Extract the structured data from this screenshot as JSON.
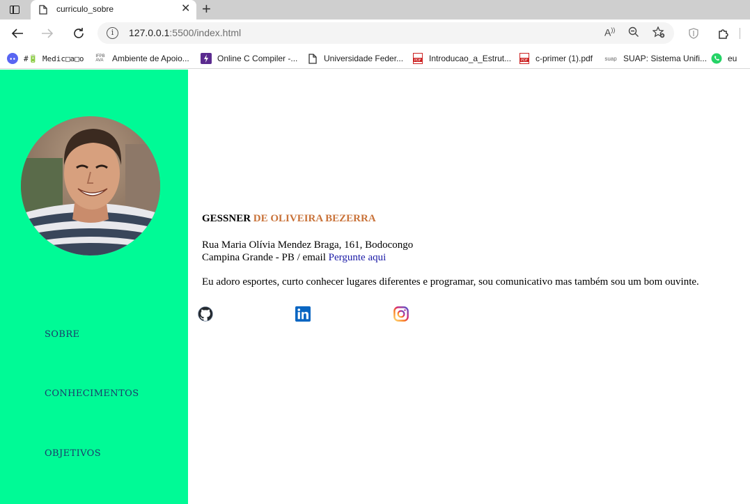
{
  "browser": {
    "tab_title": "curriculo_sobre",
    "url_host": "127.0.0.1",
    "url_rest": ":5500/index.html",
    "bookmarks": [
      {
        "label": "#🔋 Medic□a□o",
        "icon": "discord-icon"
      },
      {
        "label": "Ambiente de Apoio...",
        "icon": "ifpb-ava-icon"
      },
      {
        "label": "Online C Compiler -...",
        "icon": "compiler-icon"
      },
      {
        "label": "Universidade Feder...",
        "icon": "page-icon"
      },
      {
        "label": "Introducao_a_Estrut...",
        "icon": "pdf-icon"
      },
      {
        "label": "c-primer (1).pdf",
        "icon": "pdf-icon"
      },
      {
        "label": "SUAP: Sistema Unifi...",
        "icon": "suap-icon"
      },
      {
        "label": "eu",
        "icon": "whatsapp-icon"
      }
    ]
  },
  "page": {
    "colors": {
      "sidebar": "#00fa96",
      "accent_surname": "#c9733a",
      "link": "#1a1aa6"
    },
    "menu": [
      "SOBRE",
      "CONHECIMENTOS",
      "OBJETIVOS"
    ],
    "name_first": "GESSNER ",
    "name_last": "DE OLIVEIRA BEZERRA",
    "address_line1": "Rua Maria Olívia Mendez Braga, 161, Bodocongo",
    "address_line2": "Campina Grande - PB / email ",
    "email_link": "Pergunte aqui",
    "bio": "Eu adoro esportes, curto conhecer lugares diferentes e programar, sou comunicativo mas também sou um bom ouvinte.",
    "social": [
      "github-icon",
      "linkedin-icon",
      "instagram-icon"
    ]
  }
}
